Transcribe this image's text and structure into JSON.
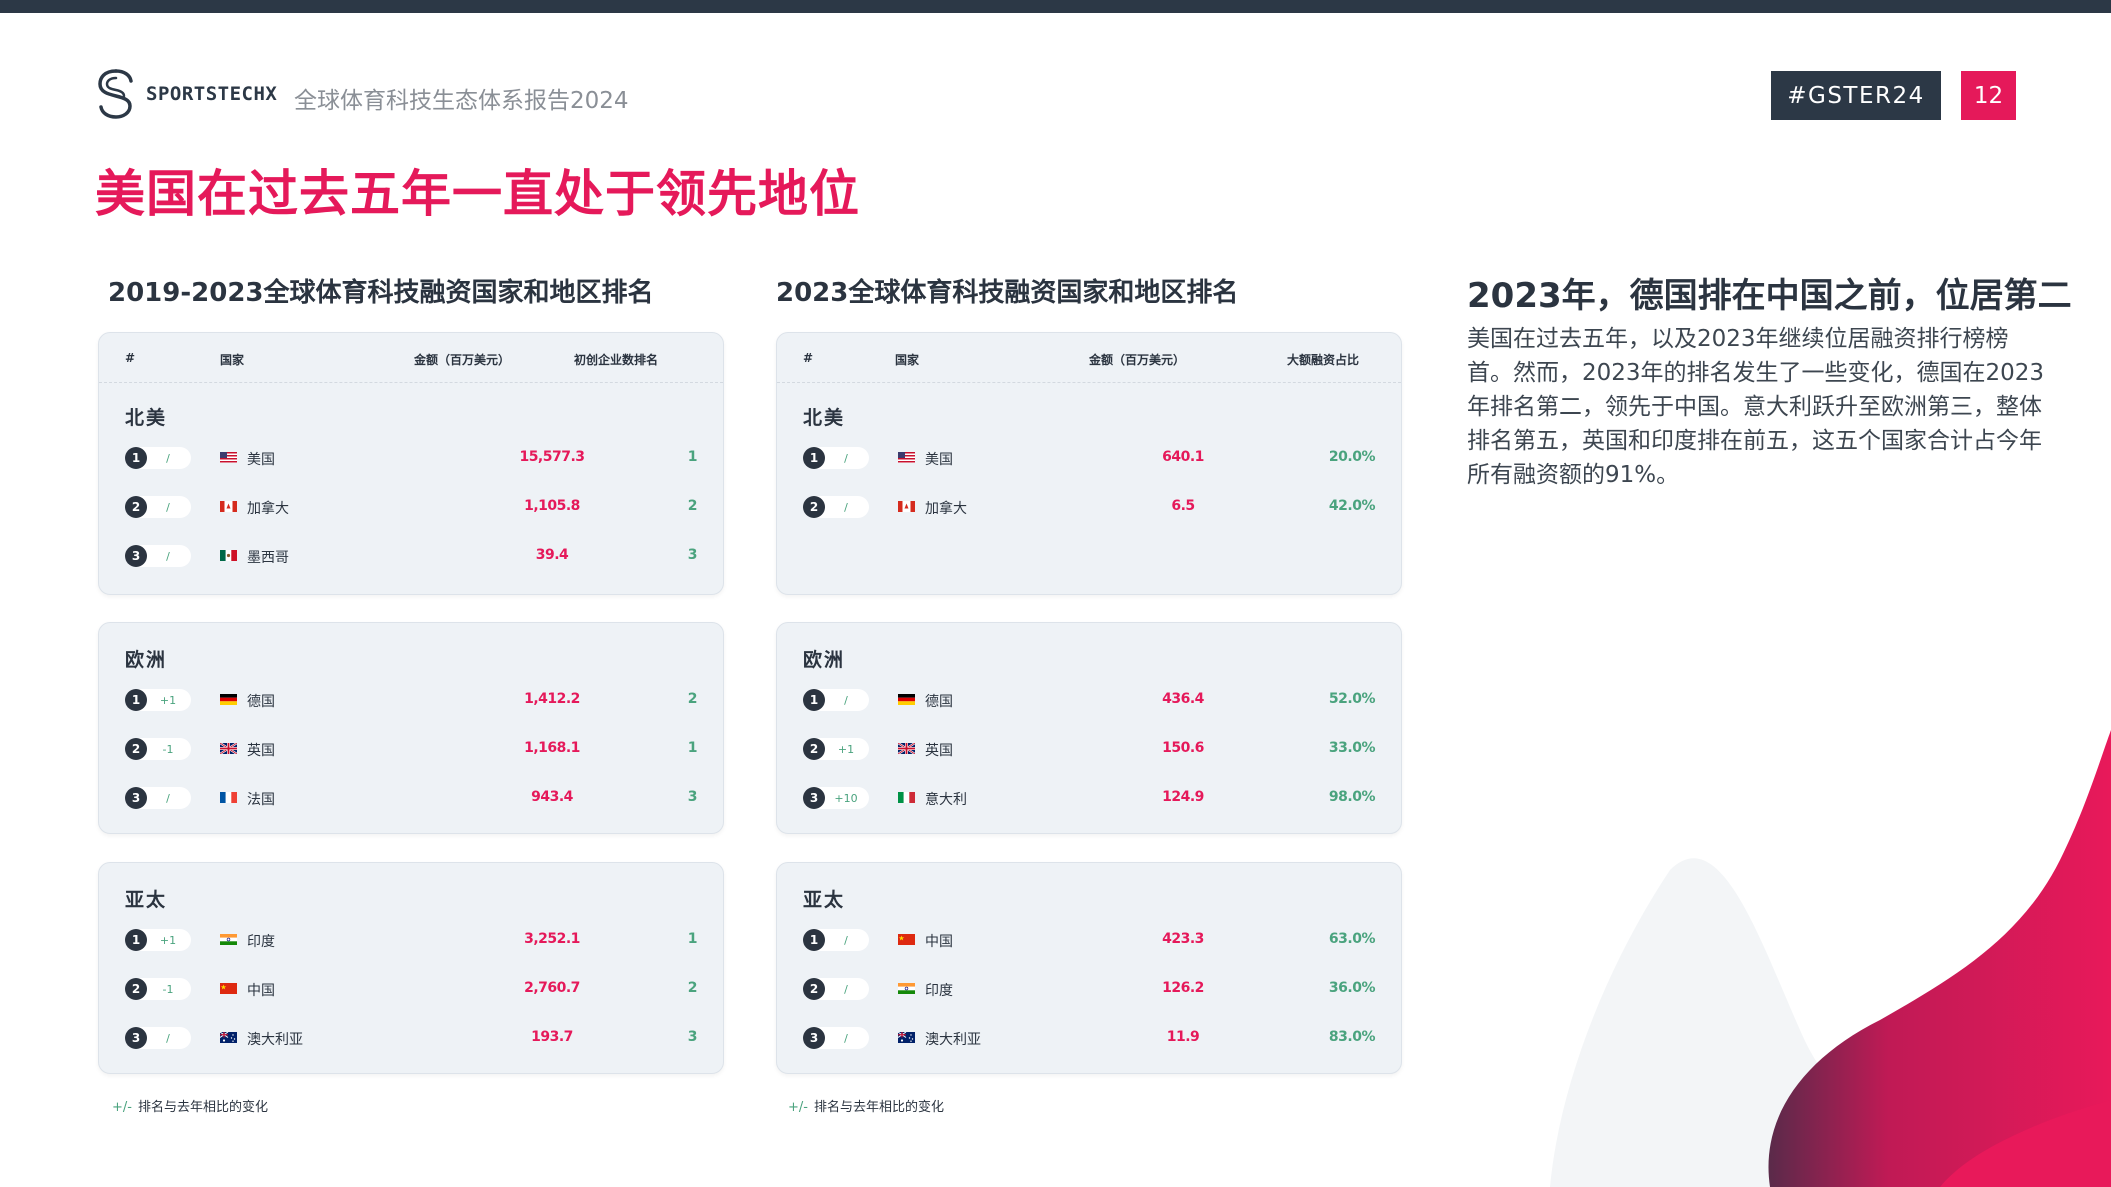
{
  "brand": "SPORTSTECHX",
  "report_title": "全球体育科技生态体系报告2024",
  "hashtag": "#GSTER24",
  "page_number": "12",
  "headline": "美国在过去五年一直处于领先地位",
  "left": {
    "title": "2019-2023全球体育科技融资国家和地区排名",
    "headers": [
      "#",
      "国家",
      "金额（百万美元）",
      "初创企业数排名"
    ],
    "regions": [
      {
        "name": "北美",
        "rows": [
          {
            "rank": "1",
            "change": "/",
            "flag": "us",
            "country": "美国",
            "amount": "15,577.3",
            "last": "1"
          },
          {
            "rank": "2",
            "change": "/",
            "flag": "ca",
            "country": "加拿大",
            "amount": "1,105.8",
            "last": "2"
          },
          {
            "rank": "3",
            "change": "/",
            "flag": "mx",
            "country": "墨西哥",
            "amount": "39.4",
            "last": "3"
          }
        ]
      },
      {
        "name": "欧洲",
        "rows": [
          {
            "rank": "1",
            "change": "+1",
            "flag": "de",
            "country": "德国",
            "amount": "1,412.2",
            "last": "2"
          },
          {
            "rank": "2",
            "change": "-1",
            "flag": "gb",
            "country": "英国",
            "amount": "1,168.1",
            "last": "1"
          },
          {
            "rank": "3",
            "change": "/",
            "flag": "fr",
            "country": "法国",
            "amount": "943.4",
            "last": "3"
          }
        ]
      },
      {
        "name": "亚太",
        "rows": [
          {
            "rank": "1",
            "change": "+1",
            "flag": "in",
            "country": "印度",
            "amount": "3,252.1",
            "last": "1"
          },
          {
            "rank": "2",
            "change": "-1",
            "flag": "cn",
            "country": "中国",
            "amount": "2,760.7",
            "last": "2"
          },
          {
            "rank": "3",
            "change": "/",
            "flag": "au",
            "country": "澳大利亚",
            "amount": "193.7",
            "last": "3"
          }
        ]
      }
    ]
  },
  "right": {
    "title": "2023全球体育科技融资国家和地区排名",
    "headers": [
      "#",
      "国家",
      "金额（百万美元）",
      "大额融资占比"
    ],
    "regions": [
      {
        "name": "北美",
        "rows": [
          {
            "rank": "1",
            "change": "/",
            "flag": "us",
            "country": "美国",
            "amount": "640.1",
            "last": "20.0%"
          },
          {
            "rank": "2",
            "change": "/",
            "flag": "ca",
            "country": "加拿大",
            "amount": "6.5",
            "last": "42.0%"
          }
        ]
      },
      {
        "name": "欧洲",
        "rows": [
          {
            "rank": "1",
            "change": "/",
            "flag": "de",
            "country": "德国",
            "amount": "436.4",
            "last": "52.0%"
          },
          {
            "rank": "2",
            "change": "+1",
            "flag": "gb",
            "country": "英国",
            "amount": "150.6",
            "last": "33.0%"
          },
          {
            "rank": "3",
            "change": "+10",
            "flag": "it",
            "country": "意大利",
            "amount": "124.9",
            "last": "98.0%"
          }
        ]
      },
      {
        "name": "亚太",
        "rows": [
          {
            "rank": "1",
            "change": "/",
            "flag": "cn",
            "country": "中国",
            "amount": "423.3",
            "last": "63.0%"
          },
          {
            "rank": "2",
            "change": "/",
            "flag": "in",
            "country": "印度",
            "amount": "126.2",
            "last": "36.0%"
          },
          {
            "rank": "3",
            "change": "/",
            "flag": "au",
            "country": "澳大利亚",
            "amount": "11.9",
            "last": "83.0%"
          }
        ]
      }
    ]
  },
  "footnote": {
    "symbol": "+/-",
    "text": "排名与去年相比的变化"
  },
  "side": {
    "title": "2023年，德国排在中国之前，位居第二",
    "body": "美国在过去五年，以及2023年继续位居融资排行榜榜首。然而，2023年的排名发生了一些变化，德国在2023年排名第二，领先于中国。意大利跃升至欧洲第三，整体排名第五，英国和印度排在前五，这五个国家合计占今年所有融资额的91%。"
  },
  "colors": {
    "accent": "#e5195a",
    "dark": "#2c3846",
    "green": "#4aa37e",
    "card": "#eef2f6"
  }
}
